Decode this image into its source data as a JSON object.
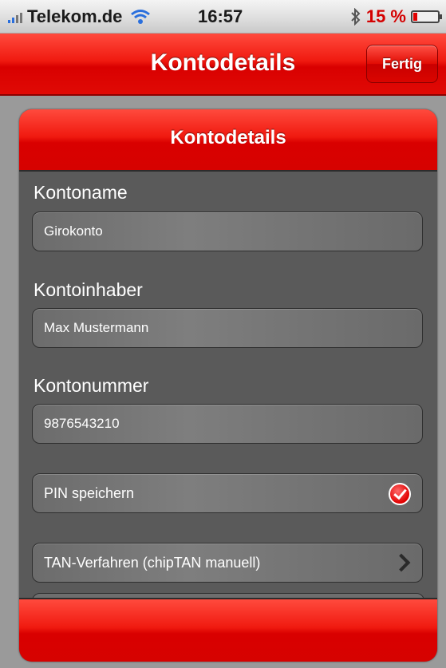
{
  "status": {
    "carrier": "Telekom.de",
    "time": "16:57",
    "battery_text": "15 %",
    "battery_level": 0.15,
    "bluetooth_icon": "bluetooth-icon",
    "wifi_icon": "wifi-icon"
  },
  "navbar": {
    "title": "Kontodetails",
    "done_label": "Fertig"
  },
  "card": {
    "title": "Kontodetails",
    "fields": {
      "account_name_label": "Kontoname",
      "account_name_value": "Girokonto",
      "holder_label": "Kontoinhaber",
      "holder_value": "Max Mustermann",
      "number_label": "Kontonummer",
      "number_value": "9876543210"
    },
    "pin_label": "PIN speichern",
    "pin_checked": true,
    "tan_label": "TAN-Verfahren (chipTAN manuell)"
  },
  "colors": {
    "accent": "#e00a05",
    "card_bg": "#5a5a5a",
    "page_bg": "#9a9a9a"
  }
}
